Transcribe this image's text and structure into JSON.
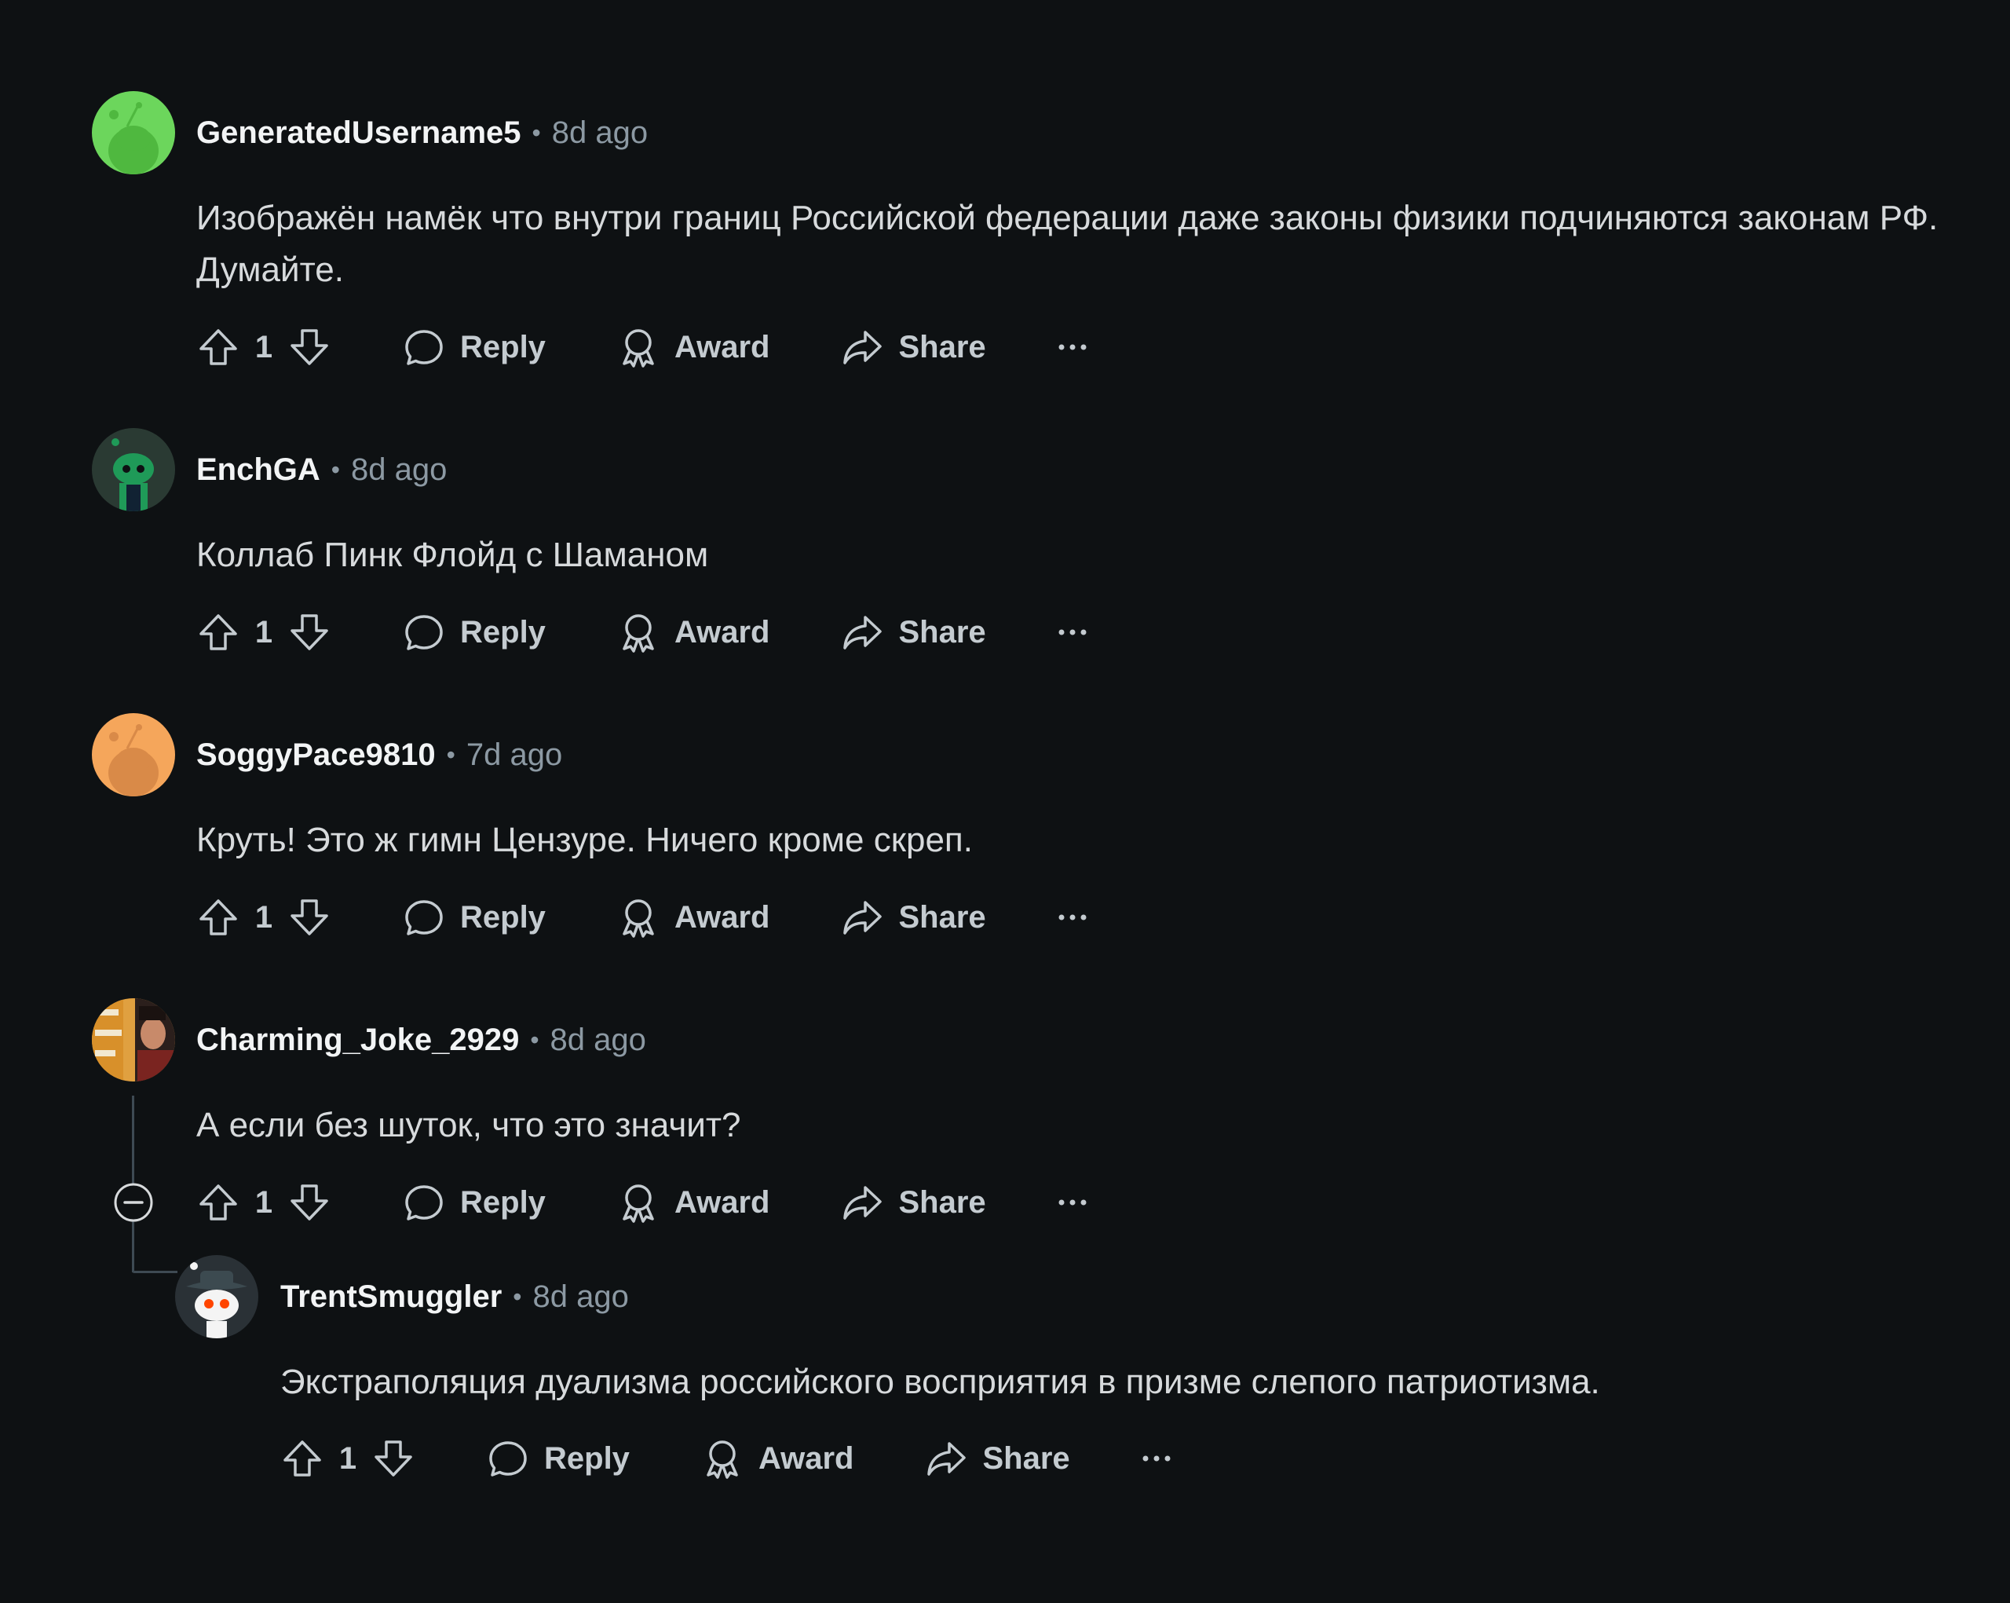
{
  "labels": {
    "reply": "Reply",
    "award": "Award",
    "share": "Share"
  },
  "comments": [
    {
      "username": "GeneratedUsername5",
      "time": "8d ago",
      "body": "Изображён намёк что внутри границ Российской федерации даже законы физики подчиняются законам РФ. Думайте.",
      "votes": "1",
      "avatar_color": "#6cd65c"
    },
    {
      "username": "EnchGA",
      "time": "8d ago",
      "body": "Коллаб Пинк Флойд с Шаманом",
      "votes": "1",
      "avatar_color": "#1a2a22"
    },
    {
      "username": "SoggyPace9810",
      "time": "7d ago",
      "body": "Круть! Это ж гимн Цензуре. Ничего кроме скреп.",
      "votes": "1",
      "avatar_color": "#f5a65b"
    },
    {
      "username": "Charming_Joke_2929",
      "time": "8d ago",
      "body": "А если без шуток, что это значит?",
      "votes": "1",
      "avatar_color": "#3a2a22"
    },
    {
      "username": "TrentSmuggler",
      "time": "8d ago",
      "body": "Экстраполяция дуализма российского восприятия в призме слепого патриотизма.",
      "votes": "1",
      "avatar_color": "#2a3136"
    }
  ]
}
